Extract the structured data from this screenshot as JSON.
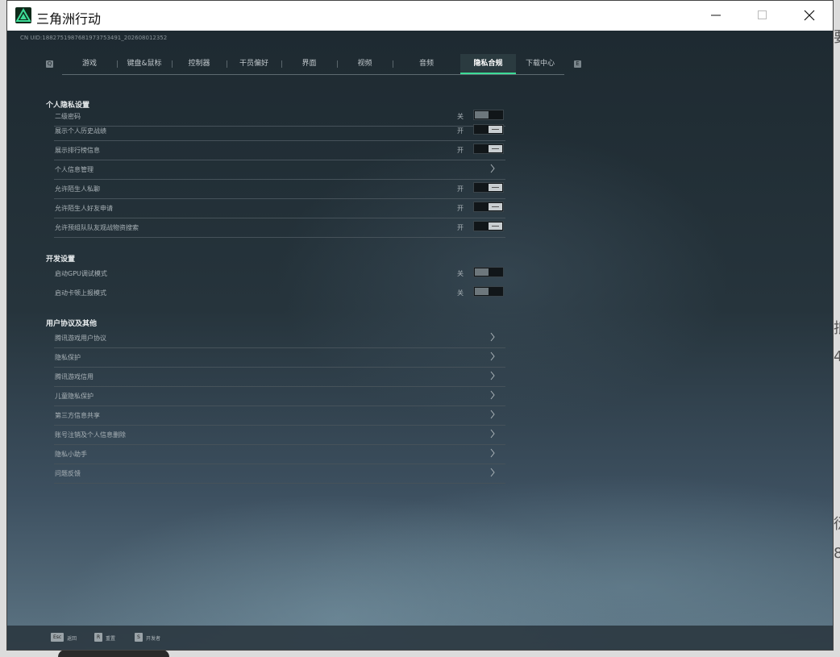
{
  "window": {
    "title": "三角洲行动"
  },
  "header": {
    "uid_text": "CN UID:1882751987681973753491_202608012352",
    "tab_prev_key": "Q",
    "tab_next_key": "E"
  },
  "tabs": [
    {
      "label": "游戏",
      "active": false
    },
    {
      "label": "键盘&鼠标",
      "active": false
    },
    {
      "label": "控制器",
      "active": false
    },
    {
      "label": "干员偏好",
      "active": false
    },
    {
      "label": "界面",
      "active": false
    },
    {
      "label": "视频",
      "active": false
    },
    {
      "label": "音频",
      "active": false
    },
    {
      "label": "隐私合规",
      "active": true
    },
    {
      "label": "下载中心",
      "active": false
    }
  ],
  "sections": {
    "personal": {
      "title": "个人隐私设置",
      "rows": [
        {
          "label": "二级密码",
          "state": "关",
          "type": "toggle",
          "on": false
        },
        {
          "label": "展示个人历史战绩",
          "state": "开",
          "type": "toggle",
          "on": true
        },
        {
          "label": "展示排行榜信息",
          "state": "开",
          "type": "toggle",
          "on": true
        },
        {
          "label": "个人信息管理",
          "state": "",
          "type": "link"
        },
        {
          "label": "允许陌生人私聊",
          "state": "开",
          "type": "toggle",
          "on": true
        },
        {
          "label": "允许陌生人好友申请",
          "state": "开",
          "type": "toggle",
          "on": true
        },
        {
          "label": "允许预组队队友观战物资搜索",
          "state": "开",
          "type": "toggle",
          "on": true
        }
      ]
    },
    "dev": {
      "title": "开发设置",
      "rows": [
        {
          "label": "启动GPU调试模式",
          "state": "关",
          "type": "toggle",
          "on": false
        },
        {
          "label": "启动卡顿上报模式",
          "state": "关",
          "type": "toggle",
          "on": false
        }
      ]
    },
    "agreements": {
      "title": "用户协议及其他",
      "rows": [
        {
          "label": "腾讯游戏用户协议",
          "type": "link"
        },
        {
          "label": "隐私保护",
          "type": "link"
        },
        {
          "label": "腾讯游戏信用",
          "type": "link"
        },
        {
          "label": "儿童隐私保护",
          "type": "link"
        },
        {
          "label": "第三方信息共享",
          "type": "link"
        },
        {
          "label": "账号注销及个人信息删除",
          "type": "link"
        },
        {
          "label": "隐私小助手",
          "type": "link"
        },
        {
          "label": "问题反馈",
          "type": "link"
        }
      ]
    }
  },
  "footer": [
    {
      "key": "Esc",
      "label": "返回"
    },
    {
      "key": "R",
      "label": "重置"
    },
    {
      "key": "S",
      "label": "开发者"
    }
  ],
  "colors": {
    "accent": "#3ddc97",
    "background": "#1c252b"
  }
}
